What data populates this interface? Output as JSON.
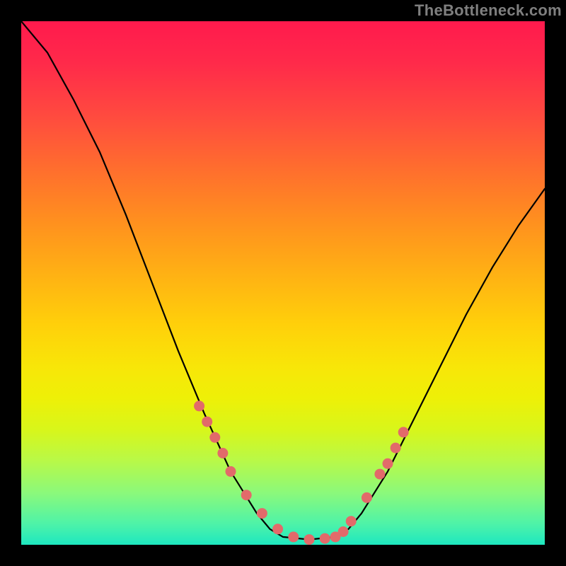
{
  "watermark": "TheBottleneck.com",
  "chart_data": {
    "type": "line",
    "title": "",
    "xlabel": "",
    "ylabel": "",
    "xlim": [
      0,
      1
    ],
    "ylim": [
      0,
      1
    ],
    "series": [
      {
        "name": "bottleneck-curve",
        "x": [
          0.0,
          0.05,
          0.1,
          0.15,
          0.2,
          0.25,
          0.3,
          0.35,
          0.4,
          0.45,
          0.475,
          0.5,
          0.55,
          0.6,
          0.625,
          0.65,
          0.7,
          0.75,
          0.8,
          0.85,
          0.9,
          0.95,
          1.0
        ],
        "y": [
          1.0,
          0.94,
          0.85,
          0.75,
          0.63,
          0.5,
          0.37,
          0.25,
          0.14,
          0.06,
          0.03,
          0.015,
          0.01,
          0.015,
          0.03,
          0.06,
          0.14,
          0.24,
          0.34,
          0.44,
          0.53,
          0.61,
          0.68
        ]
      }
    ],
    "markers": {
      "name": "highlight-dots",
      "x": [
        0.34,
        0.355,
        0.37,
        0.385,
        0.4,
        0.43,
        0.46,
        0.49,
        0.52,
        0.55,
        0.58,
        0.6,
        0.615,
        0.63,
        0.66,
        0.685,
        0.7,
        0.715,
        0.73
      ],
      "y": [
        0.265,
        0.235,
        0.205,
        0.175,
        0.14,
        0.095,
        0.06,
        0.03,
        0.015,
        0.01,
        0.012,
        0.015,
        0.025,
        0.045,
        0.09,
        0.135,
        0.155,
        0.185,
        0.215
      ]
    },
    "background_gradient": {
      "top": "#ff1a4d",
      "mid": "#ffd00a",
      "bottom": "#1ee7c0"
    }
  }
}
